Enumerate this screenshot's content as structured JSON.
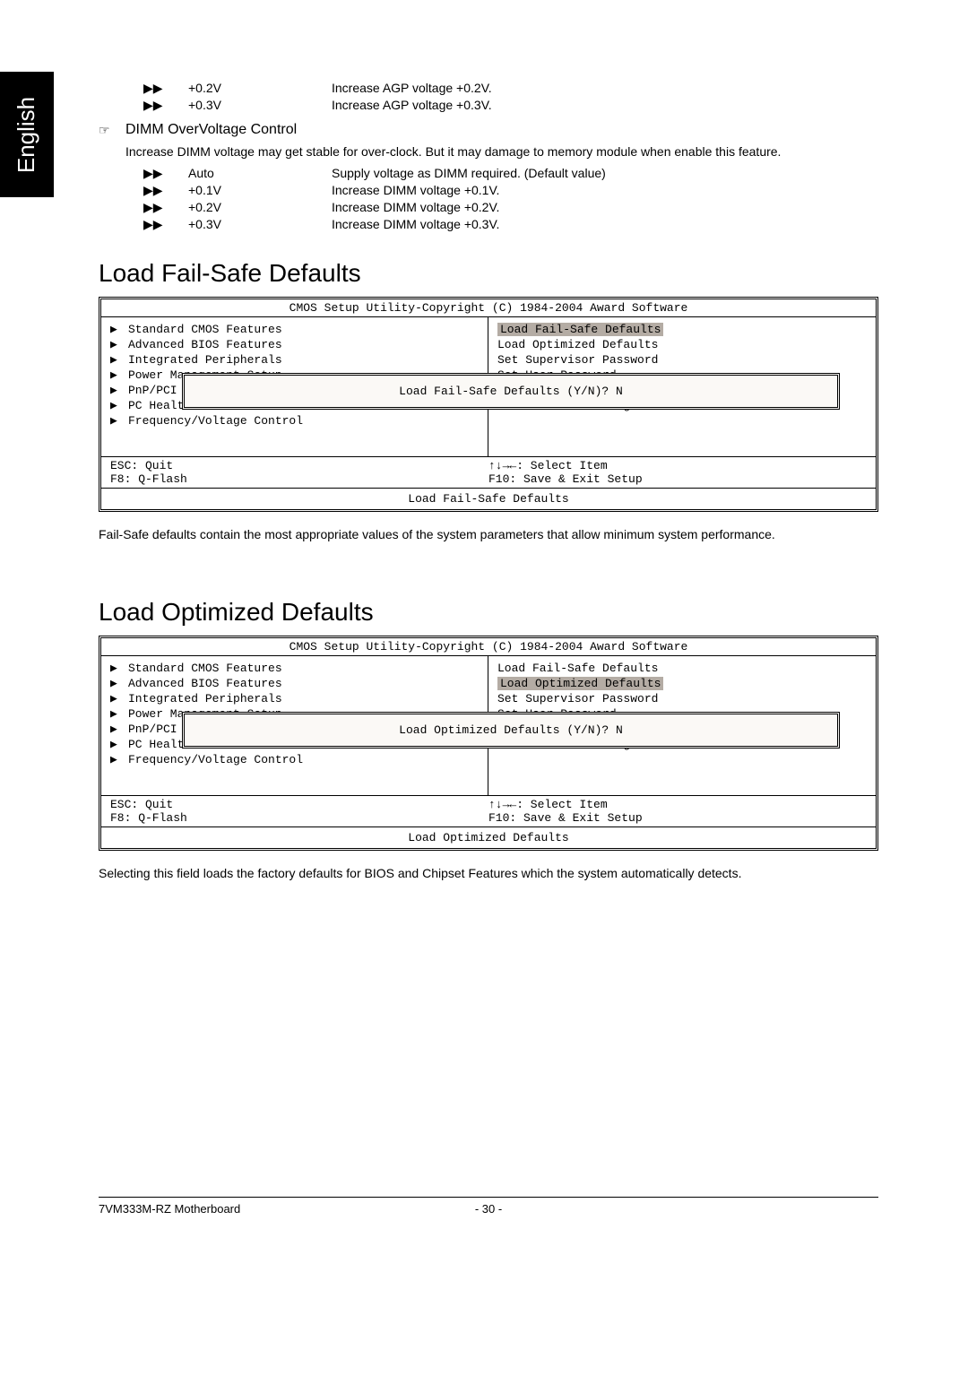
{
  "sideTab": "English",
  "agp": {
    "lines": [
      {
        "marker": "▶▶",
        "label": "+0.2V",
        "desc": "Increase AGP voltage +0.2V."
      },
      {
        "marker": "▶▶",
        "label": "+0.3V",
        "desc": "Increase AGP voltage +0.3V."
      }
    ]
  },
  "dimm": {
    "icon": "☞",
    "title": "DIMM OverVoltage Control",
    "desc": "Increase DIMM voltage may get stable for over-clock. But it may damage to memory module when enable this feature.",
    "lines": [
      {
        "marker": "▶▶",
        "label": "Auto",
        "desc": "Supply voltage as DIMM required. (Default value)"
      },
      {
        "marker": "▶▶",
        "label": "+0.1V",
        "desc": "Increase DIMM voltage +0.1V."
      },
      {
        "marker": "▶▶",
        "label": "+0.2V",
        "desc": "Increase DIMM voltage +0.2V."
      },
      {
        "marker": "▶▶",
        "label": "+0.3V",
        "desc": "Increase DIMM voltage +0.3V."
      }
    ]
  },
  "section1": {
    "title": "Load Fail-Safe Defaults",
    "bios": {
      "header": "CMOS Setup Utility-Copyright (C) 1984-2004 Award Software",
      "leftItems": [
        "Standard CMOS Features",
        "Advanced BIOS Features",
        "Integrated Peripherals",
        "Power Management Setup",
        "PnP/PCI C",
        "PC Health Status",
        "Frequency/Voltage Control"
      ],
      "rightItems": [
        {
          "text": "Load Fail-Safe Defaults",
          "hl": true
        },
        {
          "text": "Load Optimized Defaults",
          "hl": false
        },
        {
          "text": "Set Supervisor Password",
          "hl": false
        },
        {
          "text": "Set User Password",
          "hl": false
        },
        {
          "text": "",
          "hl": false
        },
        {
          "text": "Exit Without Saving",
          "hl": false
        }
      ],
      "dialog": "Load Fail-Safe Defaults (Y/N)? N",
      "footerL1": "ESC: Quit",
      "footerL2": "F8: Q-Flash",
      "footerR1": "↑↓→←: Select Item",
      "footerR2": "F10: Save & Exit Setup",
      "footerBottom": "Load Fail-Safe Defaults"
    },
    "after": "Fail-Safe defaults contain the most appropriate values of the system parameters that allow minimum system performance."
  },
  "section2": {
    "title": "Load Optimized Defaults",
    "bios": {
      "header": "CMOS Setup Utility-Copyright (C) 1984-2004 Award Software",
      "leftItems": [
        "Standard CMOS Features",
        "Advanced BIOS Features",
        "Integrated Peripherals",
        "Power Management Setup",
        "PnP/PCI C",
        "PC Health Status",
        "Frequency/Voltage Control"
      ],
      "rightItems": [
        {
          "text": "Load Fail-Safe Defaults",
          "hl": false
        },
        {
          "text": "Load Optimized Defaults",
          "hl": true
        },
        {
          "text": "Set Supervisor Password",
          "hl": false
        },
        {
          "text": "Set User Password",
          "hl": false
        },
        {
          "text": "",
          "hl": false
        },
        {
          "text": "Exit Without Saving",
          "hl": false
        }
      ],
      "dialog": "Load Optimized Defaults (Y/N)? N",
      "footerL1": "ESC: Quit",
      "footerL2": "F8: Q-Flash",
      "footerR1": "↑↓→←: Select Item",
      "footerR2": "F10: Save & Exit Setup",
      "footerBottom": "Load Optimized Defaults"
    },
    "after": "Selecting this field loads the factory defaults for BIOS and Chipset Features which the system automatically detects."
  },
  "footer": {
    "left": "7VM333M-RZ Motherboard",
    "center": "- 30 -"
  }
}
